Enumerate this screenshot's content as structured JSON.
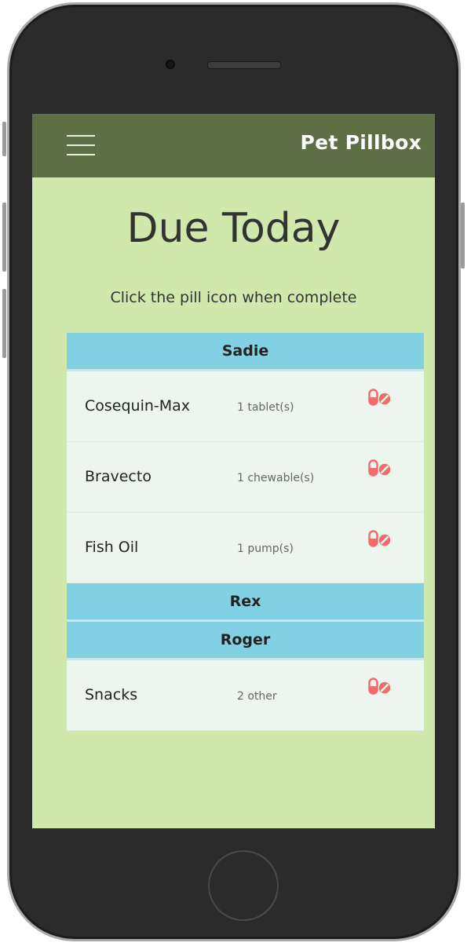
{
  "app": {
    "title": "Pet Pillbox"
  },
  "page": {
    "title": "Due Today",
    "subtitle": "Click the pill icon when complete"
  },
  "colors": {
    "header_bar": "#5f6f45",
    "background": "#d1e8ad",
    "pet_header": "#82d1e2",
    "row_background": "#edf6ee",
    "pill_icon": "#f36b6b"
  },
  "pets": [
    {
      "name": "Sadie",
      "meds": [
        {
          "name": "Cosequin-Max",
          "dose": "1 tablet(s)",
          "icon": "pill-icon"
        },
        {
          "name": "Bravecto",
          "dose": "1 chewable(s)",
          "icon": "pill-icon"
        },
        {
          "name": "Fish Oil",
          "dose": "1 pump(s)",
          "icon": "pill-icon"
        }
      ]
    },
    {
      "name": "Rex",
      "meds": []
    },
    {
      "name": "Roger",
      "meds": [
        {
          "name": "Snacks",
          "dose": "2 other",
          "icon": "pill-icon"
        }
      ]
    }
  ]
}
